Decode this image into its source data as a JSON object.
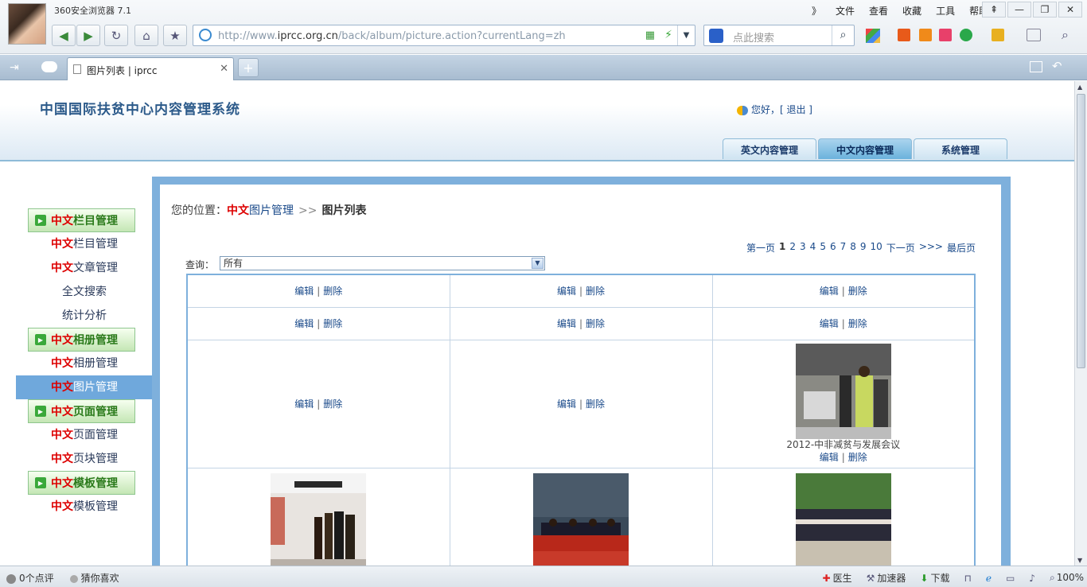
{
  "browser": {
    "app_title": "360安全浏览器 7.1",
    "menu": [
      "》",
      "文件",
      "查看",
      "收藏",
      "工具",
      "帮助"
    ],
    "window_buttons": [
      "⇞",
      "—",
      "❐",
      "✕"
    ],
    "url_prefix": "http://www.",
    "url_domain": "iprcc.org.cn",
    "url_path": "/back/album/picture.action?currentLang=zh",
    "search_placeholder": "点此搜索",
    "tab_title": "图片列表 | iprcc"
  },
  "header": {
    "site_title": "中国国际扶贫中心内容管理系统",
    "greeting": "您好，[ 退出 ]",
    "tabs": [
      {
        "label": "英文内容管理",
        "active": false
      },
      {
        "label": "中文内容管理",
        "active": true
      },
      {
        "label": "系统管理",
        "active": false
      }
    ]
  },
  "sidebar": {
    "groups": [
      {
        "head_red": "中文",
        "head_rest": "栏目管理",
        "items": [
          {
            "red": "中文",
            "rest": "栏目管理"
          },
          {
            "red": "中文",
            "rest": "文章管理"
          },
          {
            "red": "",
            "rest": "全文搜索"
          },
          {
            "red": "",
            "rest": "统计分析"
          }
        ]
      },
      {
        "head_red": "中文",
        "head_rest": "相册管理",
        "items": [
          {
            "red": "中文",
            "rest": "相册管理"
          },
          {
            "red": "中文",
            "rest": "图片管理"
          }
        ]
      },
      {
        "head_red": "中文",
        "head_rest": "页面管理",
        "items": [
          {
            "red": "中文",
            "rest": "页面管理"
          },
          {
            "red": "中文",
            "rest": "页块管理"
          }
        ]
      },
      {
        "head_red": "中文",
        "head_rest": "模板管理",
        "items": [
          {
            "red": "中文",
            "rest": "模板管理"
          }
        ]
      }
    ]
  },
  "content": {
    "breadcrumb_prefix": "您的位置：",
    "breadcrumb_red": "中文",
    "breadcrumb_blue": "图片管理",
    "breadcrumb_sep": ">>",
    "breadcrumb_current": "图片列表",
    "pager_first": "第一页",
    "pager_current": "1",
    "pager_pages": [
      "2",
      "3",
      "4",
      "5",
      "6",
      "7",
      "8",
      "9",
      "10"
    ],
    "pager_next": "下一页",
    "pager_more": ">>>",
    "pager_last": "最后页",
    "query_label": "查询：",
    "query_value": "所有",
    "edit_label": "编辑",
    "delete_label": "删除",
    "caption": "2012-中非减贫与发展会议"
  },
  "statusbar": {
    "comments": "0个点评",
    "guess": "猜你喜欢",
    "doctor": "医生",
    "accelerator": "加速器",
    "download": "下载",
    "zoom": "100%"
  }
}
